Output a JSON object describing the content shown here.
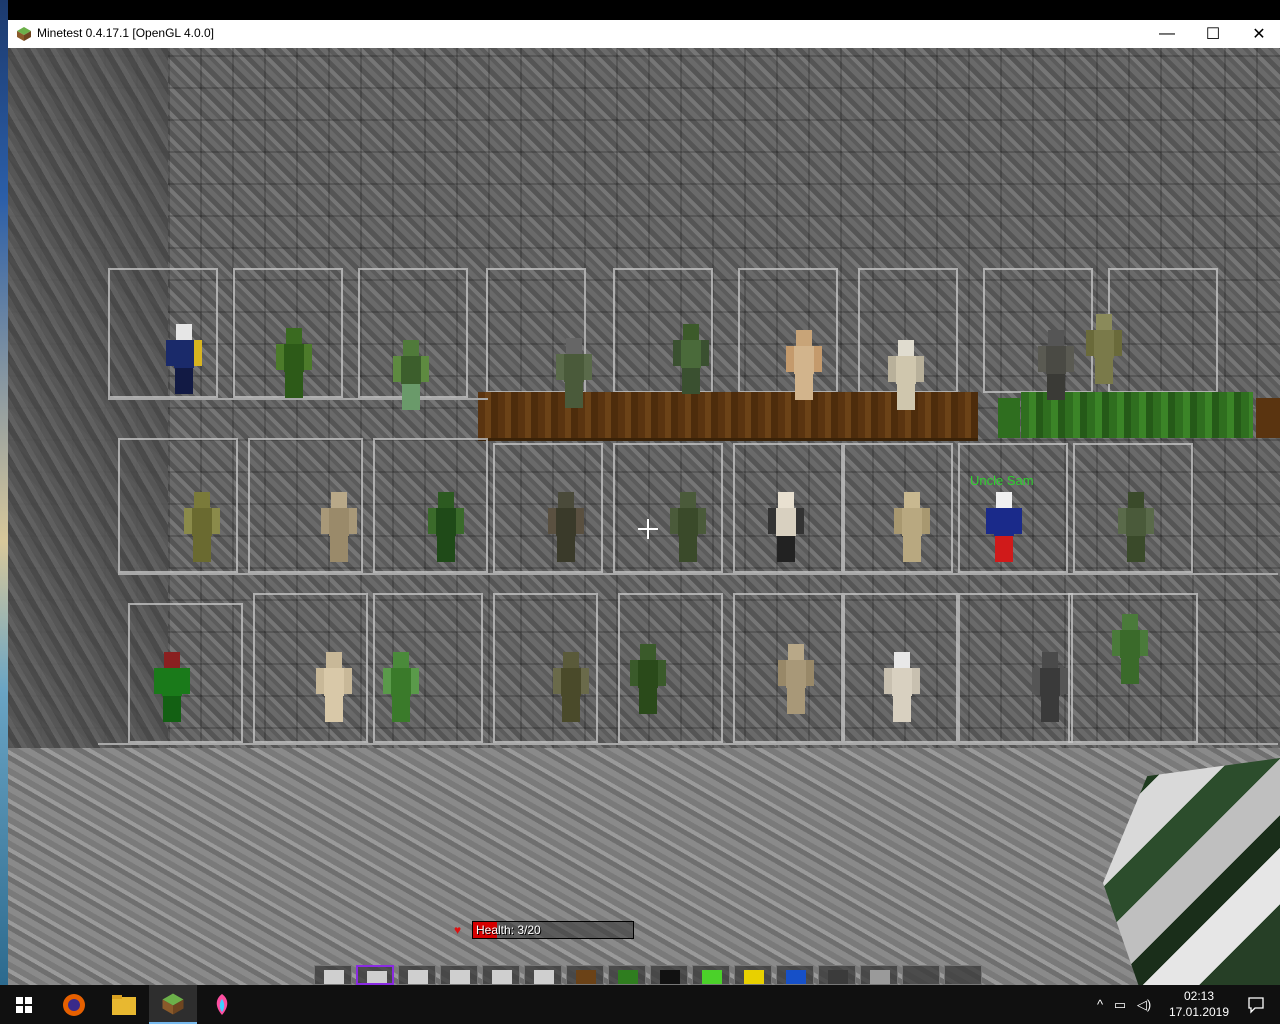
{
  "window": {
    "title": "Minetest 0.4.17.1 [OpenGL 4.0.0]",
    "minimize": "—",
    "maximize": "☐",
    "close": "✕"
  },
  "game": {
    "nametag": "Uncle Sam",
    "health": {
      "label": "Health: 3/20",
      "current": 3,
      "max": 20
    },
    "hotbar": {
      "selected_index": 1,
      "slots": [
        {
          "name": "skin-item",
          "color": "#cfcfcf"
        },
        {
          "name": "skin-item",
          "color": "#cfcfcf"
        },
        {
          "name": "skin-item",
          "color": "#cfcfcf"
        },
        {
          "name": "skin-item",
          "color": "#cfcfcf"
        },
        {
          "name": "skin-item",
          "color": "#cfcfcf"
        },
        {
          "name": "skin-item",
          "color": "#cfcfcf"
        },
        {
          "name": "dirt-block",
          "color": "#6b4217"
        },
        {
          "name": "grass-block",
          "color": "#2f7d1f"
        },
        {
          "name": "black-item",
          "color": "#111111"
        },
        {
          "name": "green-block",
          "color": "#4bd12a"
        },
        {
          "name": "yellow-block",
          "color": "#e8d000"
        },
        {
          "name": "blue-block",
          "color": "#1650c8"
        },
        {
          "name": "sapling-item",
          "color": "#3b3b3b"
        },
        {
          "name": "glass-block",
          "color": "#9a9a9a"
        },
        {
          "name": "empty",
          "color": ""
        },
        {
          "name": "empty",
          "color": ""
        }
      ]
    }
  },
  "taskbar": {
    "apps": [
      "windows-start",
      "firefox",
      "file-explorer",
      "minetest",
      "paint-app"
    ],
    "time": "02:13",
    "date": "17.01.2019",
    "tray_up": "^"
  }
}
